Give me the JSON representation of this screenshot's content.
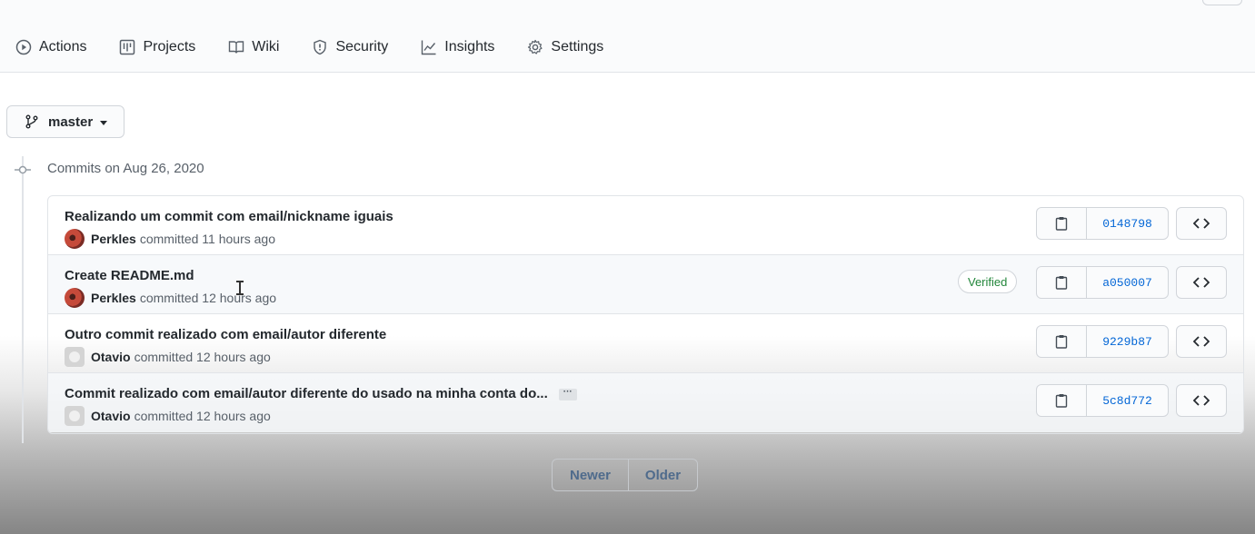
{
  "nav": {
    "items": [
      {
        "label": "Actions",
        "icon": "play-icon"
      },
      {
        "label": "Projects",
        "icon": "project-icon"
      },
      {
        "label": "Wiki",
        "icon": "book-icon"
      },
      {
        "label": "Security",
        "icon": "shield-icon"
      },
      {
        "label": "Insights",
        "icon": "graph-icon"
      },
      {
        "label": "Settings",
        "icon": "gear-icon"
      }
    ]
  },
  "branch": {
    "label": "master",
    "icon": "git-branch-icon"
  },
  "commit_group": {
    "title": "Commits on Aug 26, 2020"
  },
  "commits": [
    {
      "message": "Realizando um commit com email/nickname iguais",
      "author": "Perkles",
      "meta": "committed 11 hours ago",
      "sha": "0148798",
      "verified": "",
      "avatar": "red"
    },
    {
      "message": "Create README.md",
      "author": "Perkles",
      "meta": "committed 12 hours ago",
      "sha": "a050007",
      "verified": "Verified",
      "avatar": "red"
    },
    {
      "message": "Outro commit realizado com email/autor diferente",
      "author": "Otavio",
      "meta": "committed 12 hours ago",
      "sha": "9229b87",
      "verified": "",
      "avatar": "gray"
    },
    {
      "message": "Commit realizado com email/autor diferente do usado na minha conta do...",
      "author": "Otavio",
      "meta": "committed 12 hours ago",
      "sha": "5c8d772",
      "verified": "",
      "avatar": "gray",
      "ellipsis": "···"
    }
  ],
  "pagination": {
    "newer": "Newer",
    "older": "Older"
  },
  "colors": {
    "link": "#0366d6",
    "verified": "#22863a",
    "border": "#e1e4e8"
  }
}
